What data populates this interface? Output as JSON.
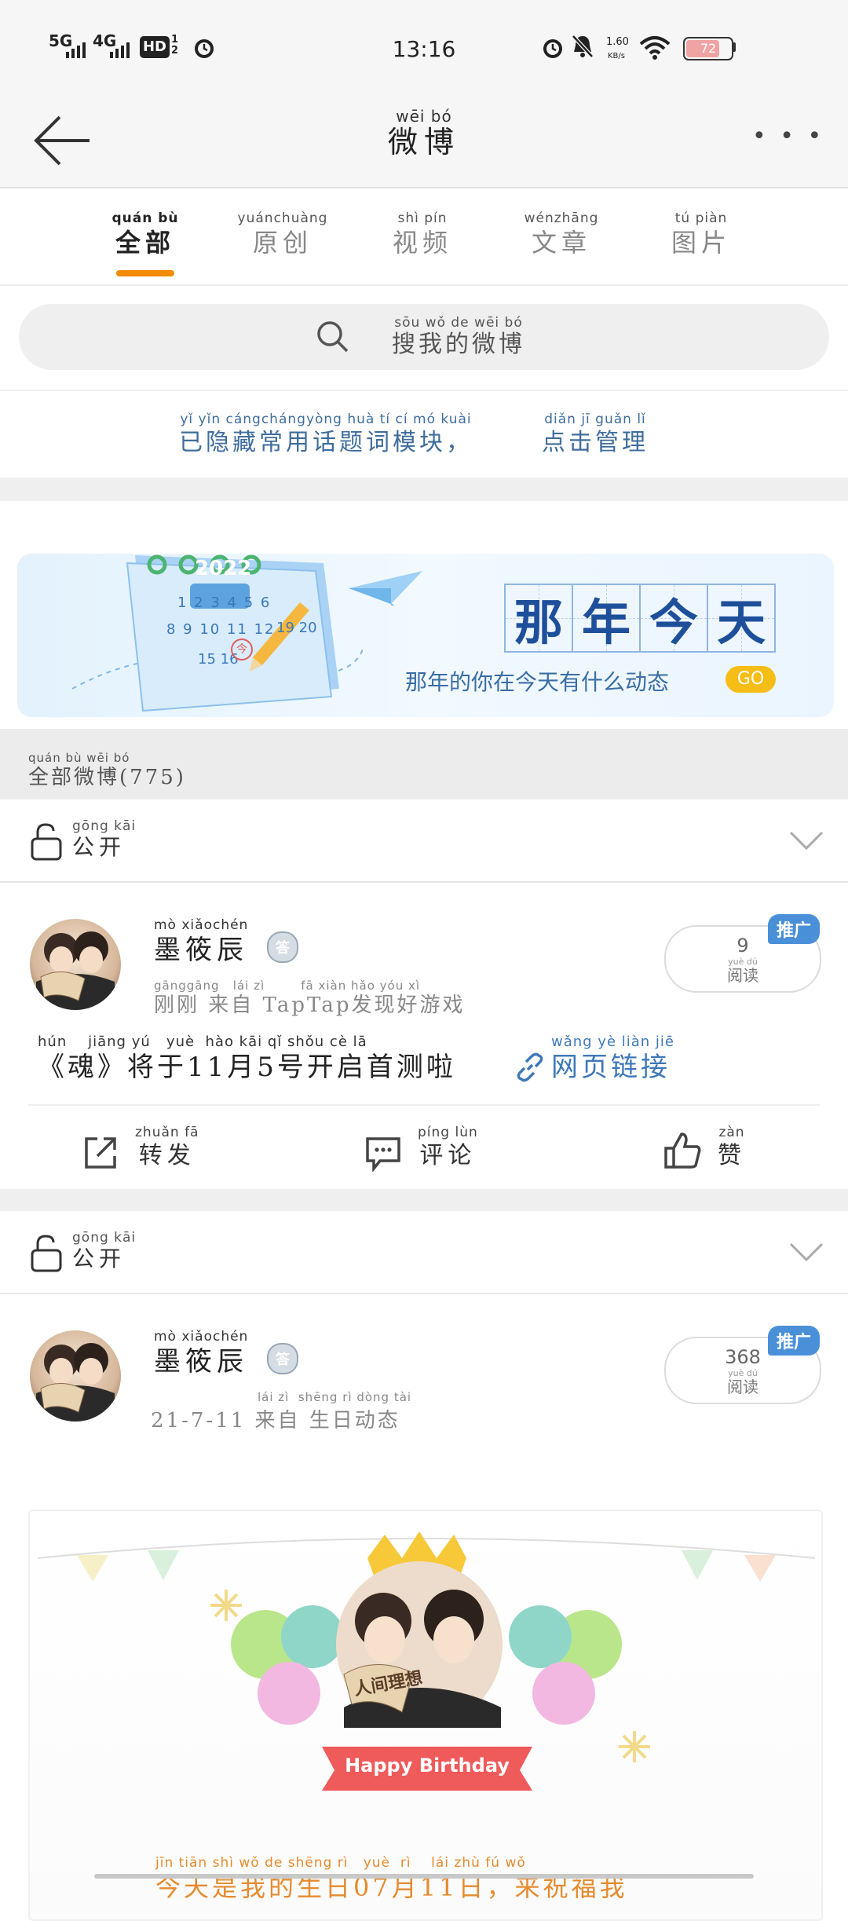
{
  "status_bar": {
    "network1": "5G",
    "network2": "4G",
    "hd": "HD",
    "hd_sub": "1 2",
    "time": "13:16",
    "speed_value": "1.60",
    "speed_unit": "KB/s",
    "battery": "72"
  },
  "header": {
    "title": "微博",
    "title_pinyin": "wēi bó",
    "more": "• • •"
  },
  "tabs": [
    {
      "label": "全部",
      "pinyin": "quán bù"
    },
    {
      "label": "原创",
      "pinyin": "yuánchuàng"
    },
    {
      "label": "视频",
      "pinyin": "shì pín"
    },
    {
      "label": "文章",
      "pinyin": "wénzhāng"
    },
    {
      "label": "图片",
      "pinyin": "tú piàn"
    }
  ],
  "search": {
    "placeholder": "搜我的微博",
    "pinyin": "sōu wǒ de wēi bó"
  },
  "hidden_notice": {
    "text": "已隐藏常用话题词模块，",
    "text_pinyin": "yǐ yǐn cángchángyòng huà tí cí mó kuài",
    "action": "点击管理",
    "action_pinyin": "diǎn jī guǎn lǐ"
  },
  "banner": {
    "title_chars": [
      "那",
      "年",
      "今",
      "天"
    ],
    "calendar_year": "2022",
    "calendar_days1": "1 2 3 4 5 6",
    "calendar_days2": "8 9 10 11 12",
    "calendar_days3": "15 16",
    "calendar_days4": "19 20",
    "calendar_mark": "今",
    "subtitle": "那年的你在今天有什么动态",
    "go": "GO"
  },
  "count_bar": {
    "label": "全部微博(775)",
    "pinyin": "quán bù wēi bó"
  },
  "posts": [
    {
      "privacy": "公开",
      "privacy_pinyin": "gōng kāi",
      "author": "墨筱辰",
      "author_pinyin": "mò xiǎochén",
      "badge": "答",
      "meta": "刚刚 来自 TapTap发现好游戏",
      "meta_pinyin": "gānggāng   lái zì        fā xiàn hǎo yóu xì",
      "read_count": "9",
      "read_label": "阅读",
      "read_pinyin": "yuè dú",
      "promo": "推广",
      "content": "《魂》将于11月5号开启首测啦",
      "content_pinyin": "hún    jiāng yú   yuè  hào kāi qǐ shǒu cè lā",
      "link": "网页链接",
      "link_pinyin": "wǎng yè liàn jiē",
      "actions": [
        {
          "label": "转发",
          "pinyin": "zhuǎn fā"
        },
        {
          "label": "评论",
          "pinyin": "píng lùn"
        },
        {
          "label": "赞",
          "pinyin": "zàn"
        }
      ]
    },
    {
      "privacy": "公开",
      "privacy_pinyin": "gōng kāi",
      "author": "墨筱辰",
      "author_pinyin": "mò xiǎochén",
      "badge": "答",
      "meta": "21-7-11 来自 生日动态",
      "meta_pinyin": "lái zì  shēng rì dòng tài",
      "read_count": "368",
      "read_label": "阅读",
      "read_pinyin": "yuè dú",
      "promo": "推广",
      "birthday_banner": "Happy Birthday",
      "birthday_fan": "人间理想",
      "content": "今天是我的生日07月11日，来祝福我",
      "content_pinyin": "jīn tiān shì wǒ de shēng rì   yuè  rì    lái zhù fú wǒ"
    }
  ],
  "colors": {
    "accent_orange": "#f28b00",
    "link_blue": "#3e78b8",
    "promo_blue": "#4a90d9",
    "banner_title_blue": "#1e4f9a"
  }
}
